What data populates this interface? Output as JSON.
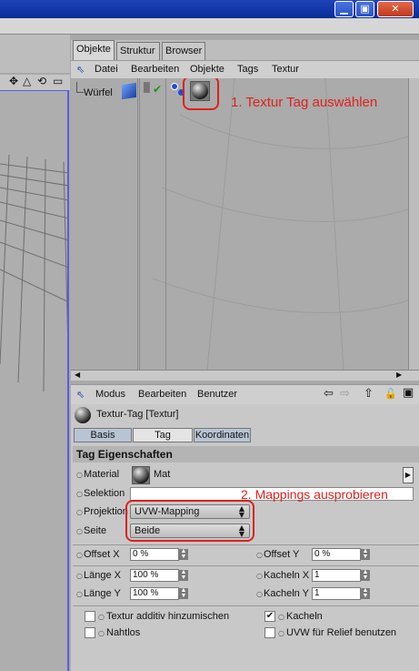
{
  "window": {
    "min_glyph": "▁",
    "max_glyph": "▣",
    "close_glyph": "✕"
  },
  "viewport": {
    "tool_icons": [
      "✥",
      "△",
      "⟲",
      "▭"
    ]
  },
  "manager_tabs": [
    "Objekte",
    "Struktur",
    "Browser"
  ],
  "obj_menu": {
    "items": [
      "Datei",
      "Bearbeiten",
      "Objekte",
      "Tags",
      "Textur"
    ],
    "pin_icon": "pin-icon"
  },
  "object": {
    "name": "Würfel",
    "check": "✔"
  },
  "annotations": {
    "step1": "1. Textur Tag auswählen",
    "step2": "2. Mappings ausprobieren",
    "color": "#e0201c"
  },
  "attr_menu": {
    "items": [
      "Modus",
      "Bearbeiten",
      "Benutzer"
    ],
    "nav_glyphs": [
      "⇦",
      "⇨",
      "⇧",
      "🔓",
      "▣"
    ]
  },
  "attr": {
    "title": "Textur-Tag [Textur]",
    "tabs": [
      "Basis",
      "Tag",
      "Koordinaten"
    ],
    "section_title": "Tag Eigenschaften",
    "material_label": "Material",
    "material_value": "Mat",
    "selektion_label": "Selektion",
    "projektion_label": "Projektion",
    "projektion_value": "UVW-Mapping",
    "seite_label": "Seite",
    "seite_value": "Beide",
    "offset_x_label": "Offset X",
    "offset_x_value": "0 %",
    "offset_y_label": "Offset Y",
    "offset_y_value": "0 %",
    "laenge_x_label": "Länge X",
    "laenge_x_value": "100 %",
    "laenge_y_label": "Länge Y",
    "laenge_y_value": "100 %",
    "kacheln_x_label": "Kacheln X",
    "kacheln_x_value": "1",
    "kacheln_y_label": "Kacheln Y",
    "kacheln_y_value": "1",
    "textur_additiv_label": "Textur additiv hinzumischen",
    "textur_additiv_checked": "",
    "nahtlos_label": "Nahtlos",
    "nahtlos_checked": "",
    "kacheln_label": "Kacheln",
    "kacheln_checked": "✔",
    "uvw_relief_label": "UVW für Relief benutzen",
    "uvw_relief_checked": ""
  }
}
